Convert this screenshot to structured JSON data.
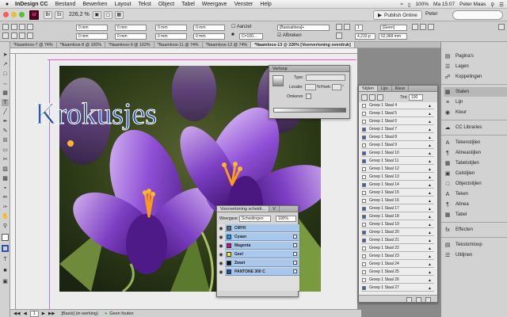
{
  "menubar": {
    "app": "InDesign CC",
    "items": [
      "Bestand",
      "Bewerken",
      "Layout",
      "Tekst",
      "Object",
      "Tabel",
      "Weergave",
      "Venster",
      "Help"
    ],
    "battery": "100%",
    "clock": "Ma 15:07",
    "user": "Peter Maas"
  },
  "appbar": {
    "logo": "Id",
    "zoom": "226,2 %",
    "publish": "Publish Online",
    "user": "Peter"
  },
  "control": {
    "fields": [
      "0 mm",
      "0 mm",
      "0 mm",
      "0 mm",
      "0 mm",
      "0 mm",
      "0 mm",
      "0 mm",
      "0 mm",
      "0 mm",
      "0 mm",
      "0 mm"
    ],
    "aanzet_label": "Aanzet",
    "afbreken_label": "Afbreken",
    "basis_dropdown": "[Basisalinea]+",
    "kleur_dropdown": "C=100...",
    "lang_dropdown": "[Geen]",
    "num_field": "4,233 p",
    "coord_field": "62,968 mm",
    "tab_count": "1"
  },
  "tabs": [
    "*Naamloos-7 @ 74%",
    "*Naamloos-8 @ 100%",
    "*Naamloos-9 @ 102%",
    "*Naamloos-11 @ 74%",
    "*Naamloos-12 @ 74%",
    "*Naamloos-13 @ 226% [Voorvertoning overdruk]"
  ],
  "canvas": {
    "title": "Krokusjes"
  },
  "verloop": {
    "title": "Verloop",
    "type_label": "Type:",
    "locatie_label": "Locatie:",
    "hoek_label": "Hoek:",
    "omkeren_label": "Omkeren",
    "pct": "%",
    "deg": "°"
  },
  "stijlen": {
    "tabs": [
      "Stijlen",
      "Lijn",
      "Kleur"
    ],
    "tint_label": "Tint:",
    "tint_value": "100",
    "rows": [
      "Groep 1 Staal 4",
      "Groep 1 Staal 5",
      "Groep 1 Staal 6",
      "Groep 1 Staal 7",
      "Groep 1 Staal 8",
      "Groep 1 Staal 9",
      "Groep 1 Staal 10",
      "Groep 1 Staal 11",
      "Groep 1 Staal 12",
      "Groep 1 Staal 13",
      "Groep 1 Staal 14",
      "Groep 1 Staal 15",
      "Groep 1 Staal 16",
      "Groep 1 Staal 17",
      "Groep 1 Staal 18",
      "Groep 1 Staal 19",
      "Groep 1 Staal 20",
      "Groep 1 Staal 21",
      "Groep 1 Staal 22",
      "Groep 1 Staal 23",
      "Groep 1 Staal 24",
      "Groep 1 Staal 25",
      "Groep 1 Staal 26",
      "Groep 1 Staal 27"
    ]
  },
  "voorvertoning": {
    "title": "Voorvertoning scheidi...",
    "tab2": "V",
    "weergave_label": "Weergave:",
    "weergave_value": "Scheidingen",
    "zoom_value": "100%",
    "inks": [
      {
        "name": "CMYK",
        "color": "#6b6b6b"
      },
      {
        "name": "Cyaan",
        "color": "#00a6e8"
      },
      {
        "name": "Magenta",
        "color": "#e8007d"
      },
      {
        "name": "Geel",
        "color": "#ffee00"
      },
      {
        "name": "Zwart",
        "color": "#111111"
      },
      {
        "name": "PANTONE 300 C",
        "color": "#1553a8"
      }
    ]
  },
  "dock": {
    "items": [
      "Pagina's",
      "Lagen",
      "Koppelingen",
      "Stalen",
      "Lijn",
      "Kleur",
      "CC Libraries",
      "Tekenstijlen",
      "Alineastijlen",
      "Tabelstijlen",
      "Celstijlen",
      "Objectstijlen",
      "Teken",
      "Alinea",
      "Tabel",
      "Effecten",
      "Tekstomloop",
      "Uitlijnen"
    ],
    "active": "Stalen"
  },
  "status": {
    "page": "1",
    "style": "[Basis] (in werking)",
    "errors": "Geen fouten"
  }
}
